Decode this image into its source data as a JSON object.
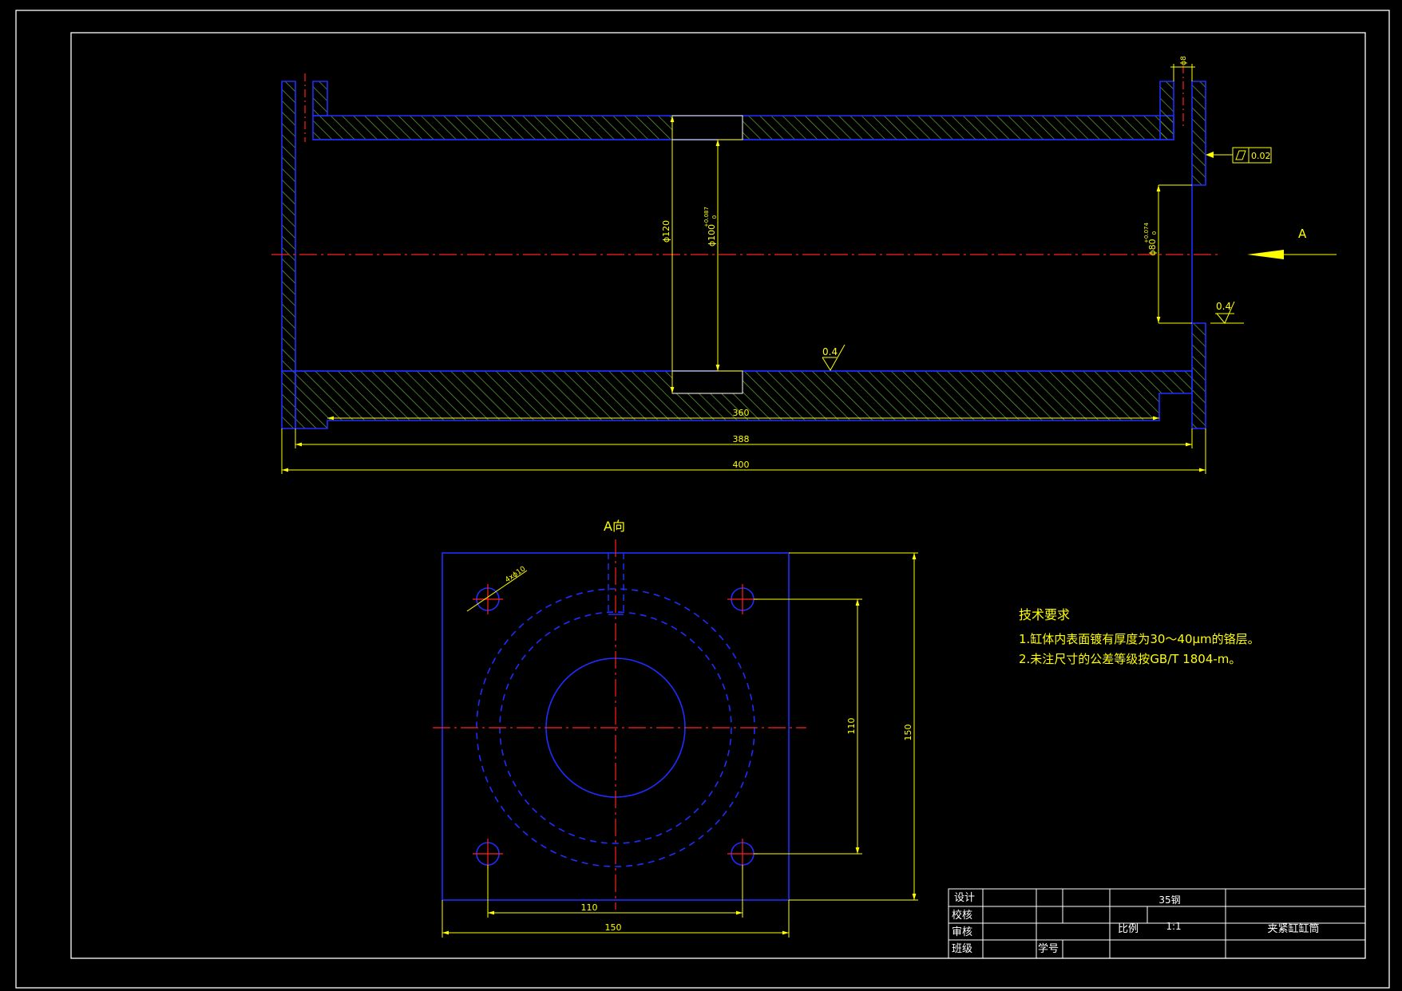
{
  "colors": {
    "background": "#000000",
    "border": "#ffffff",
    "outline": "#1f2dff",
    "hatch": "#66aa33",
    "centerline": "#ff2020",
    "dimension": "#ffff00",
    "text": "#ffffff"
  },
  "drawing": {
    "top_view": {
      "dim_outer_length": "400",
      "dim_mid_length": "388",
      "dim_inner_length": "360",
      "dim_dia_outer": "ϕ120",
      "dim_dia_bore": "ϕ100",
      "dim_dia_bore_tol": "+0.087",
      "dim_dia_bore_tol_low": "0",
      "dim_dia_end": "ϕ80",
      "dim_dia_end_tol": "+0.074",
      "dim_dia_end_tol_low": "0",
      "dim_hole": "ϕ8",
      "roughness_inner": "0.4",
      "roughness_end": "0.4",
      "flatness_value": "0.02",
      "view_marker": "A"
    },
    "a_view": {
      "title": "A向",
      "hole_callout": "4xϕ10",
      "dim_hole_spacing_v": "110",
      "dim_width_v": "150",
      "dim_hole_spacing_h": "110",
      "dim_width_h": "150"
    },
    "tech_notes": {
      "title": "技术要求",
      "items": [
        "1.缸体内表面镀有厚度为30～40μm的铬层。",
        "2.未注尺寸的公差等级按GB/T 1804-m。"
      ]
    }
  },
  "title_block": {
    "design": "设计",
    "check": "校核",
    "review": "审核",
    "class": "班级",
    "student_id": "学号",
    "material": "35钢",
    "scale_label": "比例",
    "scale_value": "1:1",
    "part_name": "夹紧缸缸筒"
  }
}
